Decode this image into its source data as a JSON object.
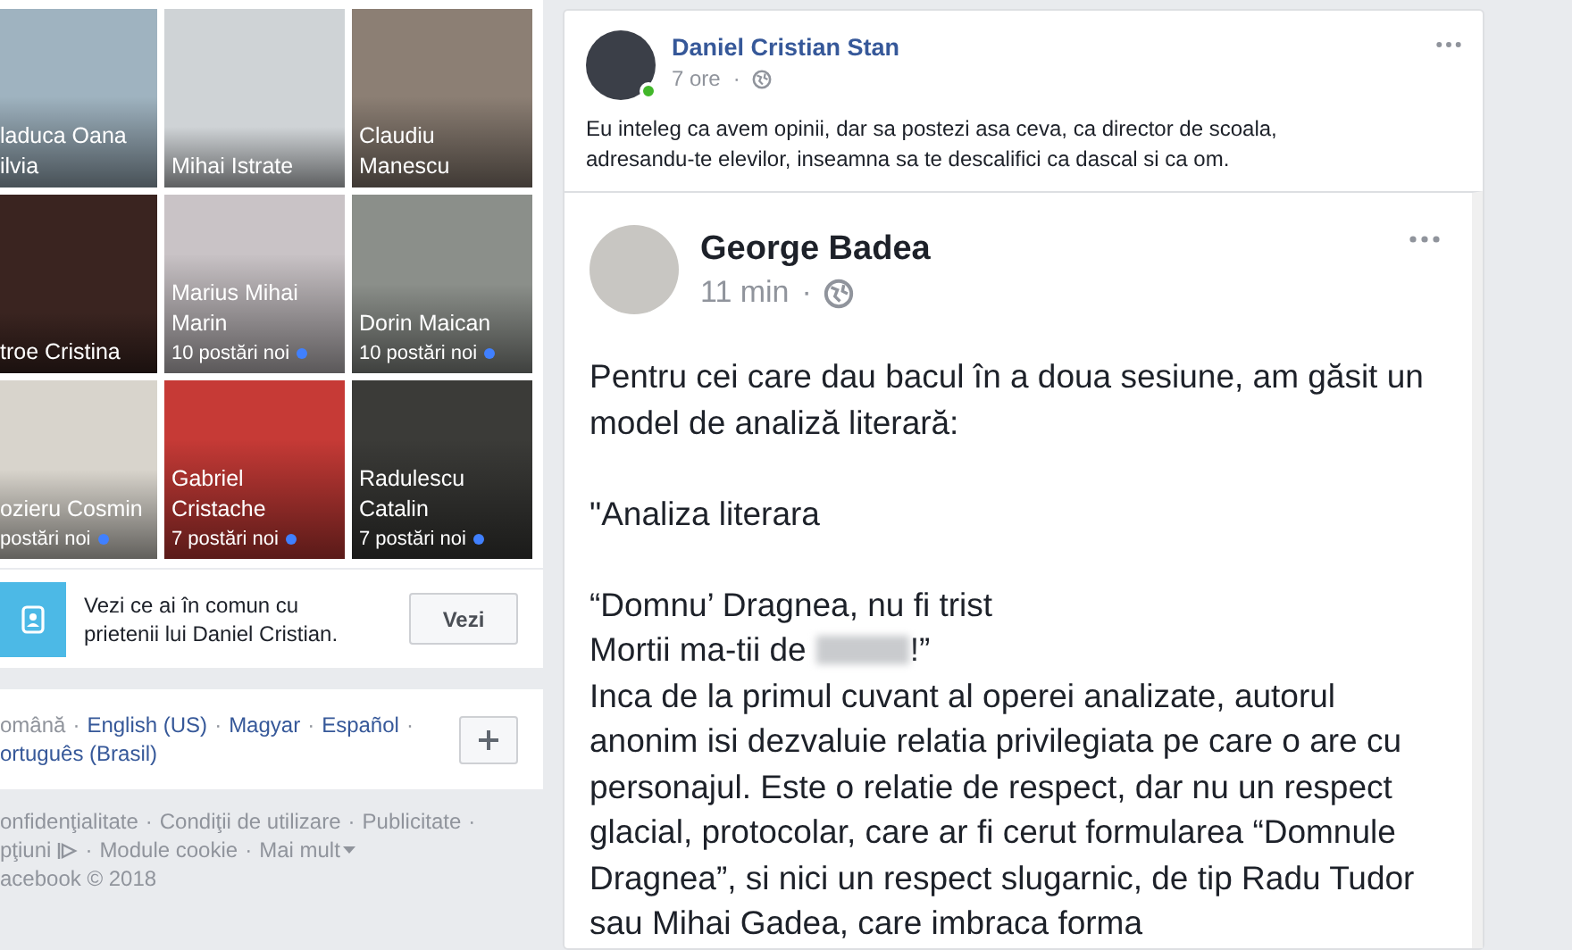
{
  "friends": [
    {
      "name_lines": [
        "laduca Oana",
        "ilvia"
      ]
    },
    {
      "name_lines": [
        "Mihai Istrate"
      ]
    },
    {
      "name_lines": [
        "Claudiu",
        "Manescu"
      ]
    },
    {
      "name_lines": [
        "troe Cristina"
      ]
    },
    {
      "name_lines": [
        "Marius Mihai",
        "Marin"
      ],
      "new_posts": "10 postări noi"
    },
    {
      "name_lines": [
        "Dorin Maican"
      ],
      "new_posts": "10 postări noi"
    },
    {
      "name_lines": [
        "ozieru Cosmin"
      ],
      "new_posts": "postări noi"
    },
    {
      "name_lines": [
        "Gabriel",
        "Cristache"
      ],
      "new_posts": "7 postări noi"
    },
    {
      "name_lines": [
        "Radulescu",
        "Catalin"
      ],
      "new_posts": "7 postări noi"
    }
  ],
  "mutual": {
    "text": "Vezi ce ai în comun cu prietenii lui Daniel Cristian.",
    "button": "Vezi"
  },
  "languages": [
    {
      "label": "omână",
      "selected": true,
      "sep": "·"
    },
    {
      "label": "English (US)",
      "selected": false,
      "sep": "·"
    },
    {
      "label": "Magyar",
      "selected": false,
      "sep": "·"
    },
    {
      "label": "Español",
      "selected": false,
      "sep": "·"
    },
    {
      "label": "ortuguês (Brasil)",
      "selected": false
    }
  ],
  "footer_links": [
    {
      "label": "onfidenţialitate",
      "sep": "·"
    },
    {
      "label": "Condiţii de utilizare",
      "sep": "·"
    },
    {
      "label": "Publicitate",
      "sep": "·"
    },
    {
      "label": "pţiuni",
      "adchoices": true,
      "sep": "·"
    },
    {
      "label": "Module cookie",
      "sep": "·"
    },
    {
      "label": "Mai mult",
      "dropdown": true
    }
  ],
  "copyright": "acebook © 2018",
  "post": {
    "author": "Daniel Cristian Stan",
    "online": true,
    "time": "7 ore",
    "time_sep": "·",
    "text": "Eu inteleg ca avem opinii, dar sa postezi asa ceva, ca director de scoala, adresandu-te elevilor, inseamna sa te descalifici ca dascal si ca om.",
    "shared": {
      "author": "George Badea",
      "time": "11 min",
      "time_sep": "·",
      "sections": [
        [
          {
            "kind": "paragraph",
            "text": "Pentru cei care dau bacul în a doua sesiune, am găsit un model de analiză literară:"
          }
        ],
        [
          {
            "kind": "paragraph",
            "text": "\"Analiza literara"
          }
        ],
        [
          {
            "kind": "paragraph",
            "text": "“Domnu’ Dragnea, nu fi trist"
          },
          {
            "kind": "censored",
            "before": "Mortii ma-tii de",
            "after": "!”"
          },
          {
            "kind": "paragraph",
            "text": "Inca de la primul cuvant al operei analizate, autorul anonim isi dezvaluie relatia privilegiata pe care o are cu personajul. Este o relatie de respect, dar nu un respect glacial, protocolar, care ar fi cerut formularea “Domnule Dragnea”, si nici un respect slugarnic, de tip Radu Tudor sau Mihai Gadea, care imbraca forma"
          }
        ]
      ]
    }
  }
}
